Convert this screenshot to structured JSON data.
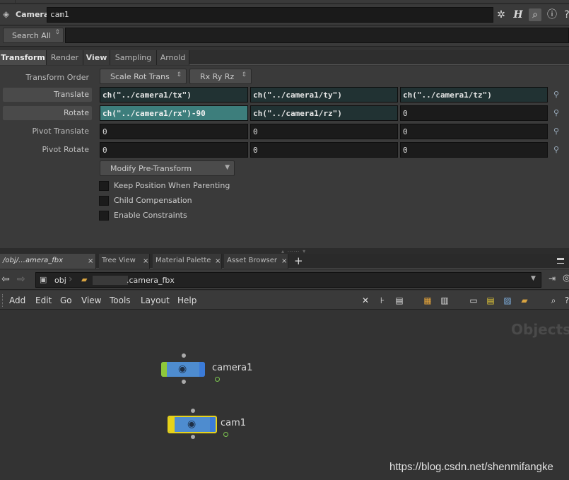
{
  "header": {
    "node_type": "Camera",
    "node_name": "cam1",
    "icons": [
      "camera-icon",
      "gear-icon",
      "help-h-icon",
      "search-icon",
      "info-icon",
      "help-icon"
    ]
  },
  "search": {
    "button_label": "Search All"
  },
  "tabs": [
    {
      "label": "Transform",
      "active": true
    },
    {
      "label": "Render",
      "active": false
    },
    {
      "label": "View",
      "active": false
    },
    {
      "label": "Sampling",
      "active": false
    },
    {
      "label": "Arnold",
      "active": false
    }
  ],
  "parms": {
    "transform_order": {
      "label": "Transform Order",
      "menu1": "Scale Rot Trans",
      "menu2": "Rx Ry Rz"
    },
    "translate": {
      "label": "Translate",
      "x": "ch(\"../camera1/tx\")",
      "y": "ch(\"../camera1/ty\")",
      "z": "ch(\"../camera1/tz\")"
    },
    "rotate": {
      "label": "Rotate",
      "x": "ch(\"../camera1/rx\")-90",
      "y": "ch(\"../camera1/rz\")",
      "z": "0"
    },
    "pivot_translate": {
      "label": "Pivot Translate",
      "x": "0",
      "y": "0",
      "z": "0"
    },
    "pivot_rotate": {
      "label": "Pivot Rotate",
      "x": "0",
      "y": "0",
      "z": "0"
    },
    "modify_pre_transform": "Modify Pre-Transform",
    "keep_position": "Keep Position When Parenting",
    "child_compensation": "Child Compensation",
    "enable_constraints": "Enable Constraints"
  },
  "pane_tabs": [
    {
      "label": "/obj/…amera_fbx"
    },
    {
      "label": "Tree View"
    },
    {
      "label": "Material Palette"
    },
    {
      "label": "Asset Browser"
    }
  ],
  "path": {
    "root": "obj",
    "node": ".camera_fbx"
  },
  "net_menu": [
    "Add",
    "Edit",
    "Go",
    "View",
    "Tools",
    "Layout",
    "Help"
  ],
  "canvas": {
    "watermark": "Objects",
    "nodes": [
      {
        "label": "camera1"
      },
      {
        "label": "cam1"
      }
    ],
    "credit": "https://blog.csdn.net/shenmifangke"
  },
  "colors": {
    "node_blue": "#4e8ccf",
    "selected_field": "#3d7e7c",
    "expr_field": "#213233",
    "display_flag": "#7ec850",
    "selected_outline": "#e6d21a"
  }
}
